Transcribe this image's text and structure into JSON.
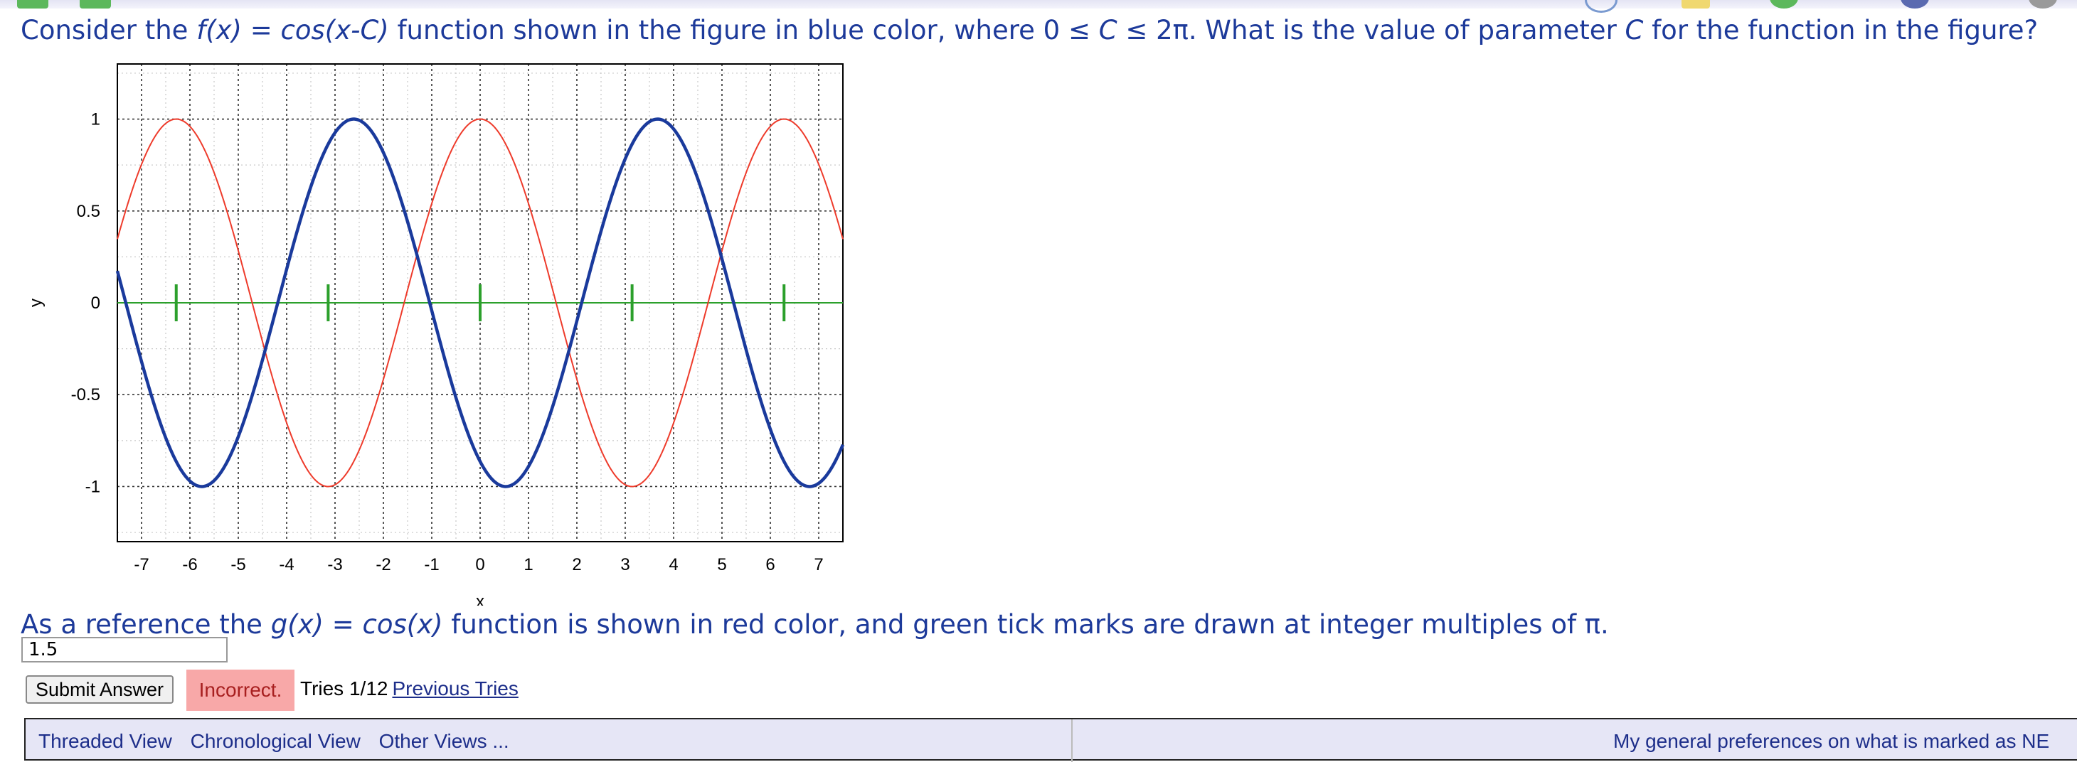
{
  "question": {
    "part1": "Consider the ",
    "fx": "f(x)",
    "eq": " = ",
    "fexpr": "cos(x-C)",
    "part2": " function shown in the figure in blue color, where 0 ≤ ",
    "c1": "C",
    "part3": " ≤ 2π. What is the value of parameter ",
    "c2": "C",
    "part4": " for the function in the figure?"
  },
  "reference": {
    "part1": "As a reference the ",
    "gx": "g(x)",
    "eq": " = ",
    "gexpr": "cos(x)",
    "part2": " function is shown in red color, and green tick marks are drawn at integer multiples of π."
  },
  "answer": {
    "value": "1.5"
  },
  "submit_label": "Submit Answer",
  "status_label": "Incorrect.",
  "tries_label": "Tries 1/12",
  "previous_tries_label": "Previous Tries",
  "discussion": {
    "threaded": "Threaded View",
    "chronological": "Chronological View",
    "other": "Other Views ...",
    "preferences": "My general preferences on what is marked as NE"
  },
  "colors": {
    "blue_curve": "#1a3a9c",
    "red_curve": "#ee3b2b",
    "green_marks": "#2ca02c",
    "status_bg": "#f8a8a8"
  },
  "chart_data": {
    "type": "line",
    "xlabel": "x",
    "ylabel": "y",
    "xlim": [
      -7.5,
      7.5
    ],
    "ylim": [
      -1.3,
      1.3
    ],
    "xticks": [
      -7,
      -6,
      -5,
      -4,
      -3,
      -2,
      -1,
      0,
      1,
      2,
      3,
      4,
      5,
      6,
      7
    ],
    "yticks": [
      -1,
      -0.5,
      0,
      0.5,
      1
    ],
    "xtick_labels": [
      "-7",
      "-6",
      "-5",
      "-4",
      "-3",
      "-2",
      "-1",
      "0",
      "1",
      "2",
      "3",
      "4",
      "5",
      "6",
      "7"
    ],
    "ytick_labels": [
      "-1",
      "-0.5",
      "0",
      "0.5",
      "1"
    ],
    "grid": true,
    "series": [
      {
        "function": "cos(x - C)",
        "C": 3.67,
        "color": "#1a3a9c"
      },
      {
        "function": "cos(x)",
        "color": "#ee3b2b"
      }
    ],
    "green_marks_x": [
      -6.2832,
      -3.1416,
      0,
      3.1416,
      6.2832
    ]
  }
}
